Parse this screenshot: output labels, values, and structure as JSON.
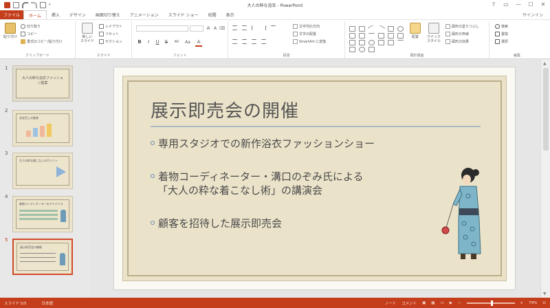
{
  "window": {
    "title": "大人の粋な浴衣 - PowerPoint",
    "controls": [
      "?",
      "▭",
      "—",
      "☐",
      "✕"
    ]
  },
  "tabs": [
    {
      "label": "ファイル",
      "kind": "file"
    },
    {
      "label": "ホーム",
      "active": true
    },
    {
      "label": "挿入"
    },
    {
      "label": "デザイン"
    },
    {
      "label": "画面切り替え"
    },
    {
      "label": "アニメーション"
    },
    {
      "label": "スライド ショー"
    },
    {
      "label": "校閲"
    },
    {
      "label": "表示"
    }
  ],
  "signin": "サインイン",
  "ribbon": {
    "clipboard": {
      "paste": "貼り付け",
      "cut": "切り取り",
      "copy": "コピー",
      "format_painter": "書式のコピー/貼り付け",
      "label": "クリップボード"
    },
    "slides": {
      "new_slide": "新しい\nスライド",
      "layout": "レイアウト",
      "reset": "リセット",
      "section": "セクション",
      "label": "スライド"
    },
    "font": {
      "label": "フォント",
      "buttons": [
        "B",
        "I",
        "U",
        "S",
        "ab",
        "AV",
        "Aa",
        "A"
      ]
    },
    "paragraph": {
      "text_direction": "文字列の方向",
      "align_text": "文字の配置",
      "smartart": "SmartArt に変換",
      "label": "段落"
    },
    "drawing": {
      "arrange": "配置",
      "quick_styles": "クイック\nスタイル",
      "shape_fill": "図形の塗りつぶし",
      "shape_outline": "図形の枠線",
      "shape_effects": "図形の効果",
      "label": "図形描画"
    },
    "editing": {
      "find": "検索",
      "replace": "置換",
      "select": "選択",
      "label": "編集"
    }
  },
  "thumbnails": [
    {
      "number": "1",
      "title": "大人の粋な浴衣ファッション提案"
    },
    {
      "number": "2",
      "title": "浴衣売上の推移"
    },
    {
      "number": "3",
      "title": "大人の粋な着こなしのポイント"
    },
    {
      "number": "4",
      "title": "着物コーディネーターのアドバイス"
    },
    {
      "number": "5",
      "title": "展示即売会の開催",
      "selected": true
    }
  ],
  "slide": {
    "title": "展示即売会の開催",
    "bullets": [
      {
        "line1": "専用スタジオでの新作浴衣ファッションショー"
      },
      {
        "line1": "着物コーディネーター・溝口のぞみ氏による",
        "line2": "「大人の粋な着こなし術」の講演会"
      },
      {
        "line1": "顧客を招待した展示即売会"
      }
    ]
  },
  "status": {
    "slide_info": "スライド 5/5",
    "language": "日本語",
    "notes": "ノート",
    "comments": "コメント",
    "zoom": "79%",
    "zoom_fraction": 0.5
  },
  "colors": {
    "accent": "#c43e1c",
    "slide_board": "#ebe3c9",
    "rule": "#aab7c4"
  }
}
